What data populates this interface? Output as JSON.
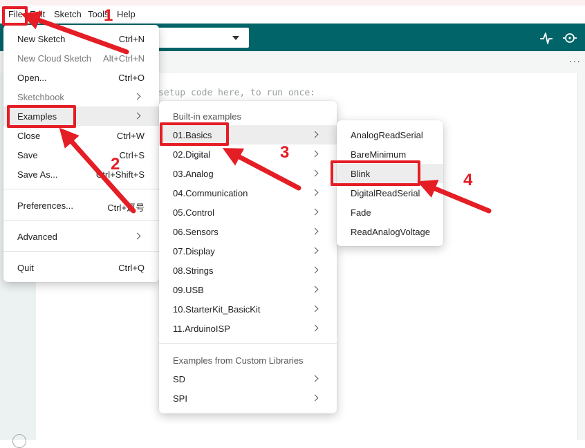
{
  "menubar": {
    "file": "File",
    "edit": "Edit",
    "sketch": "Sketch",
    "tools": "Tools",
    "help": "Help"
  },
  "editor": {
    "code_line": "setup code here, to run once:"
  },
  "file_menu": {
    "items": [
      {
        "label": "New Sketch",
        "shortcut": "Ctrl+N"
      },
      {
        "label": "New Cloud Sketch",
        "shortcut": "Alt+Ctrl+N"
      },
      {
        "label": "Open...",
        "shortcut": "Ctrl+O"
      },
      {
        "label": "Sketchbook",
        "shortcut": ""
      },
      {
        "label": "Examples",
        "shortcut": ""
      },
      {
        "label": "Close",
        "shortcut": "Ctrl+W"
      },
      {
        "label": "Save",
        "shortcut": "Ctrl+S"
      },
      {
        "label": "Save As...",
        "shortcut": "Ctrl+Shift+S"
      },
      {
        "label": "Preferences...",
        "shortcut": "Ctrl+逗号"
      },
      {
        "label": "Advanced",
        "shortcut": ""
      },
      {
        "label": "Quit",
        "shortcut": "Ctrl+Q"
      }
    ]
  },
  "examples_menu": {
    "builtin_header": "Built-in examples",
    "builtin": [
      "01.Basics",
      "02.Digital",
      "03.Analog",
      "04.Communication",
      "05.Control",
      "06.Sensors",
      "07.Display",
      "08.Strings",
      "09.USB",
      "10.StarterKit_BasicKit",
      "11.ArduinoISP"
    ],
    "custom_header": "Examples from Custom Libraries",
    "custom": [
      "SD",
      "SPI"
    ]
  },
  "basics_menu": {
    "items": [
      "AnalogReadSerial",
      "BareMinimum",
      "Blink",
      "DigitalReadSerial",
      "Fade",
      "ReadAnalogVoltage"
    ]
  },
  "annotations": {
    "step1": "1",
    "step2": "2",
    "step3": "3",
    "step4": "4",
    "color": "#e51d25"
  },
  "colors": {
    "toolbar": "#006468"
  }
}
